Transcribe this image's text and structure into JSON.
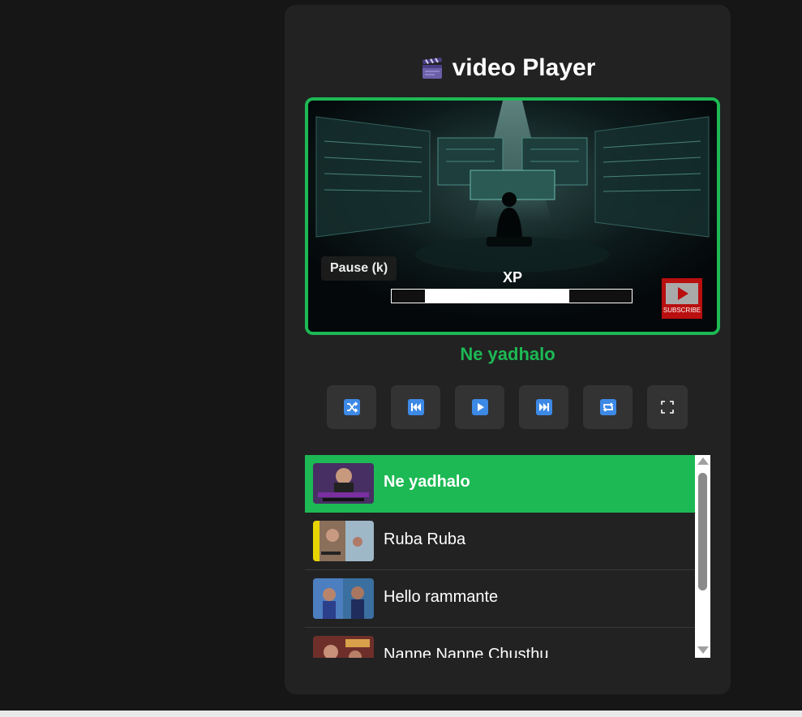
{
  "app": {
    "title": "video Player",
    "title_icon": "clapper-board-icon"
  },
  "video": {
    "tooltip": "Pause (k)",
    "overlay_label": "XP",
    "overlay_progress": 0.74,
    "subscribe_label": "SUBSCRIBE"
  },
  "now_playing": "Ne yadhalo",
  "controls": [
    {
      "name": "shuffle",
      "icon": "shuffle-icon"
    },
    {
      "name": "previous",
      "icon": "skip-previous-icon"
    },
    {
      "name": "play",
      "icon": "play-icon"
    },
    {
      "name": "next",
      "icon": "skip-next-icon"
    },
    {
      "name": "repeat",
      "icon": "repeat-icon"
    },
    {
      "name": "fullscreen",
      "icon": "fullscreen-icon"
    }
  ],
  "playlist": {
    "items": [
      {
        "title": "Ne yadhalo",
        "active": true
      },
      {
        "title": "Ruba Ruba",
        "active": false
      },
      {
        "title": "Hello rammante",
        "active": false
      },
      {
        "title": "Nanne Nanne Chusthu",
        "active": false
      }
    ]
  },
  "colors": {
    "accent": "#1db954",
    "card": "#222222",
    "page": "#161616",
    "control_icon": "#3d89e6"
  }
}
